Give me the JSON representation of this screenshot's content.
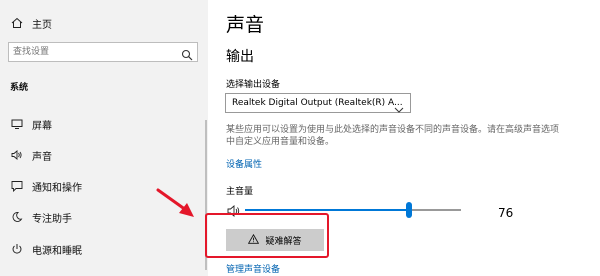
{
  "sidebar": {
    "home_label": "主页",
    "search_placeholder": "查找设置",
    "section_label": "系统",
    "items": [
      {
        "label": "屏幕",
        "icon": "monitor-icon"
      },
      {
        "label": "声音",
        "icon": "speaker-icon"
      },
      {
        "label": "通知和操作",
        "icon": "notification-icon"
      },
      {
        "label": "专注助手",
        "icon": "moon-icon"
      },
      {
        "label": "电源和睡眠",
        "icon": "power-icon"
      }
    ]
  },
  "main": {
    "page_title": "声音",
    "output_section": "输出",
    "choose_output_label": "选择输出设备",
    "output_device": "Realtek Digital Output (Realtek(R) A...",
    "description": "某些应用可以设置为使用与此处选择的声音设备不同的声音设备。请在高级声音选项中自定义应用音量和设备。",
    "device_properties_link": "设备属性",
    "master_volume_label": "主音量",
    "volume_value": "76",
    "volume_level": 0.76,
    "troubleshoot_label": "疑难解答",
    "manage_devices_link": "管理声音设备"
  },
  "colors": {
    "accent": "#0078d7",
    "link": "#0063b1",
    "highlight": "#e4172a",
    "sidebar_bg": "#f2f2f2"
  }
}
